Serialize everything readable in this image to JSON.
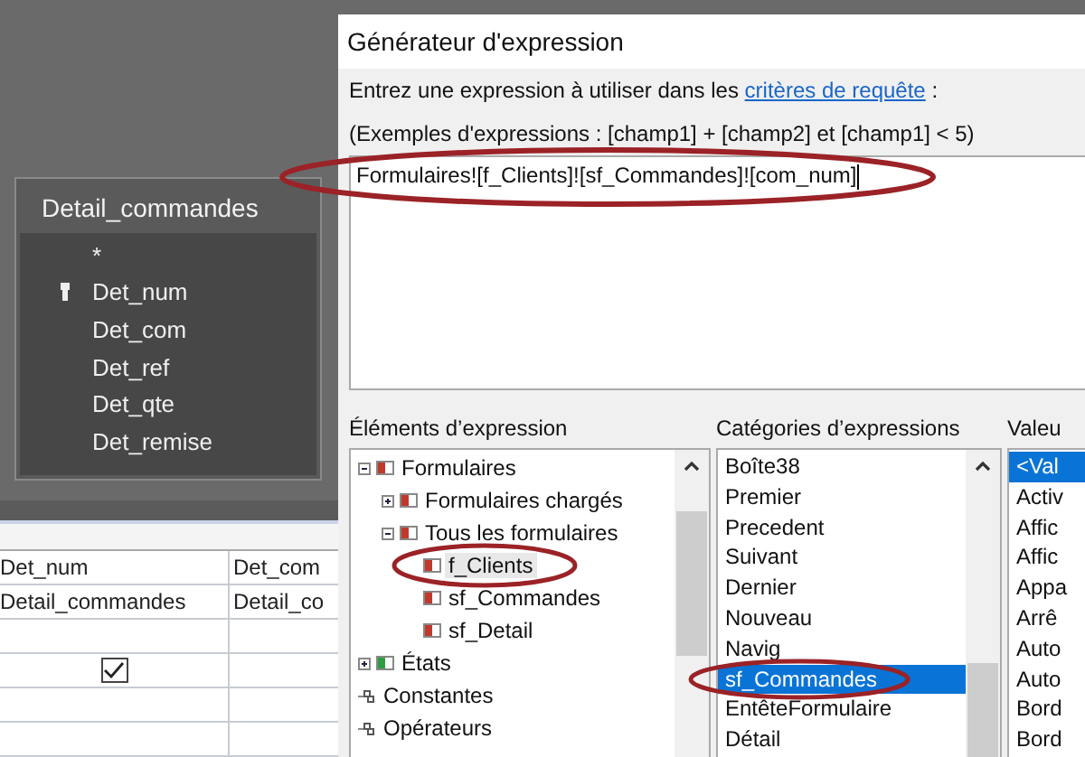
{
  "table_card": {
    "title": "Detail_commandes",
    "fields": [
      {
        "name": "*",
        "key": false
      },
      {
        "name": "Det_num",
        "key": true
      },
      {
        "name": "Det_com",
        "key": false
      },
      {
        "name": "Det_ref",
        "key": false
      },
      {
        "name": "Det_qte",
        "key": false
      },
      {
        "name": "Det_remise",
        "key": false
      }
    ]
  },
  "query_grid": {
    "columns": [
      {
        "field": "Det_num",
        "table": "Detail_commandes",
        "show": true
      },
      {
        "field": "Det_com",
        "table": "Detail_co"
      }
    ]
  },
  "dialog": {
    "title": "Générateur d'expression",
    "prompt_before": "Entrez une expression à utiliser dans les ",
    "prompt_link": "critères de requête",
    "prompt_after": " :",
    "example": "(Exemples d'expressions : [champ1] + [champ2] et [champ1] < 5)",
    "expression": "Formulaires![f_Clients]![sf_Commandes]![com_num]",
    "elements_label": "Éléments d’expression",
    "tree": [
      {
        "label": "Formulaires",
        "kind": "form",
        "expanded": true,
        "children": [
          {
            "label": "Formulaires chargés",
            "kind": "form",
            "expanded": false
          },
          {
            "label": "Tous les formulaires",
            "kind": "form",
            "expanded": true,
            "children": [
              {
                "label": "f_Clients",
                "kind": "form",
                "selected": true
              },
              {
                "label": "sf_Commandes",
                "kind": "form",
                "selected": false
              },
              {
                "label": "sf_Detail",
                "kind": "form",
                "selected": false
              }
            ]
          }
        ]
      },
      {
        "label": "États",
        "kind": "report",
        "expanded": false
      },
      {
        "label": "Constantes",
        "kind": "constant"
      },
      {
        "label": "Opérateurs",
        "kind": "constant"
      }
    ],
    "categories_label": "Catégories d’expressions",
    "categories": [
      {
        "label": "Boîte38",
        "selected": false
      },
      {
        "label": "Premier",
        "selected": false
      },
      {
        "label": "Precedent",
        "selected": false
      },
      {
        "label": "Suivant",
        "selected": false
      },
      {
        "label": "Dernier",
        "selected": false
      },
      {
        "label": "Nouveau",
        "selected": false
      },
      {
        "label": "Navig",
        "selected": false
      },
      {
        "label": "sf_Commandes",
        "selected": true
      },
      {
        "label": "EntêteFormulaire",
        "selected": false
      },
      {
        "label": "Détail",
        "selected": false
      }
    ],
    "values_label": "Valeu",
    "values": [
      {
        "label": "<Val",
        "selected": true
      },
      {
        "label": "Activ",
        "selected": false
      },
      {
        "label": "Affic",
        "selected": false
      },
      {
        "label": "Affic",
        "selected": false
      },
      {
        "label": "Appa",
        "selected": false
      },
      {
        "label": "Arrê",
        "selected": false
      },
      {
        "label": "Auto",
        "selected": false
      },
      {
        "label": "Auto",
        "selected": false
      },
      {
        "label": "Bord",
        "selected": false
      },
      {
        "label": "Bord",
        "selected": false
      }
    ]
  }
}
